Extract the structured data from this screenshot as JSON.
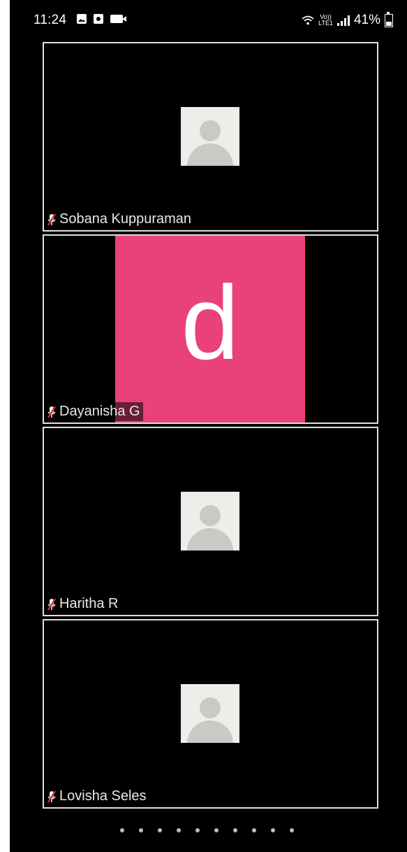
{
  "status_bar": {
    "time": "11:24",
    "left_icons": [
      "photo-icon",
      "screenshot-icon",
      "video-icon"
    ],
    "volte_label": "Vo))\nLTE1",
    "battery_percent": "41%",
    "battery_level": 0.41
  },
  "participants": [
    {
      "name": "Sobana Kuppuraman",
      "avatar_type": "placeholder",
      "muted": true
    },
    {
      "name": "Dayanisha G",
      "avatar_type": "initial",
      "initial": "d",
      "avatar_color": "#e9417b",
      "muted": true
    },
    {
      "name": "Haritha R",
      "avatar_type": "placeholder",
      "muted": true
    },
    {
      "name": "Lovisha Seles",
      "avatar_type": "placeholder",
      "muted": true
    }
  ],
  "pagination": {
    "page_count": 10
  },
  "colors": {
    "background": "#000000",
    "tile_border": "#e0e0e0",
    "mic_muted": "#d32f2f"
  }
}
